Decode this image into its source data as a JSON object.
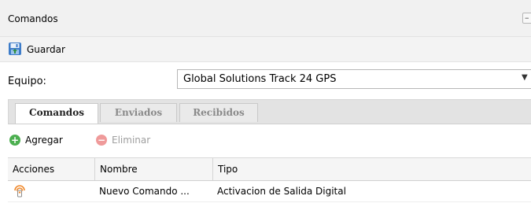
{
  "panel": {
    "title": "Comandos",
    "collapse_symbol": "–"
  },
  "toolbar": {
    "save_label": "Guardar"
  },
  "form": {
    "equipo_label": "Equipo:",
    "equipo_value": "Global Solutions Track 24 GPS"
  },
  "tabs": [
    {
      "label": "Comandos",
      "active": true
    },
    {
      "label": "Enviados",
      "active": false
    },
    {
      "label": "Recibidos",
      "active": false
    }
  ],
  "actions": {
    "add_label": "Agregar",
    "remove_label": "Eliminar"
  },
  "grid": {
    "columns": [
      "Acciones",
      "Nombre",
      "Tipo"
    ],
    "rows": [
      {
        "icon": "signal-device-icon",
        "nombre": "Nuevo Comando ...",
        "tipo": "Activacion de Salida Digital"
      }
    ]
  },
  "colors": {
    "add_green": "#4caf50",
    "remove_red": "#e57373",
    "device_orange": "#f0892c"
  }
}
